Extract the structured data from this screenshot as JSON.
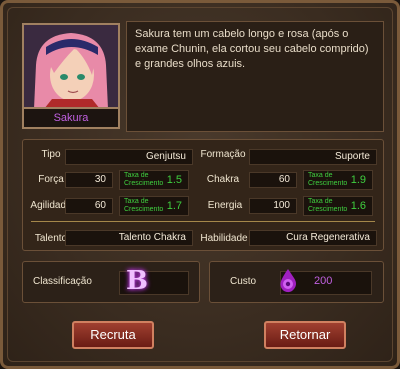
{
  "character": {
    "name": "Sakura",
    "description": "Sakura tem um cabelo longo e rosa (após o exame Chunin, ela cortou seu cabelo comprido) e grandes olhos azuis."
  },
  "stats": {
    "tipo_label": "Tipo",
    "tipo_value": "Genjutsu",
    "formacao_label": "Formação",
    "formacao_value": "Suporte",
    "forca_label": "Força",
    "forca_value": "30",
    "forca_growth_label": "Taxa de Crescimento",
    "forca_growth_value": "1.5",
    "chakra_label": "Chakra",
    "chakra_value": "60",
    "chakra_growth_label": "Taxa de Crescimento",
    "chakra_growth_value": "1.9",
    "agilidade_label": "Agilidade",
    "agilidade_value": "60",
    "agilidade_growth_label": "Taxa de Crescimento",
    "agilidade_growth_value": "1.7",
    "energia_label": "Energia",
    "energia_value": "100",
    "energia_growth_label": "Taxa de Crescimento",
    "energia_growth_value": "1.6",
    "talento_label": "Talento",
    "talento_value": "Talento Chakra",
    "habilidade_label": "Habilidade",
    "habilidade_value": "Cura Regenerativa"
  },
  "rank": {
    "label": "Classificação",
    "value": "B"
  },
  "cost": {
    "label": "Custo",
    "value": "200",
    "icon": "chakra-orb-icon"
  },
  "buttons": {
    "recruit": "Recruta",
    "back": "Retornar"
  },
  "colors": {
    "accent_purple": "#c060e0",
    "growth_green": "#3fcf3f",
    "button_red": "#8a2a1c"
  }
}
